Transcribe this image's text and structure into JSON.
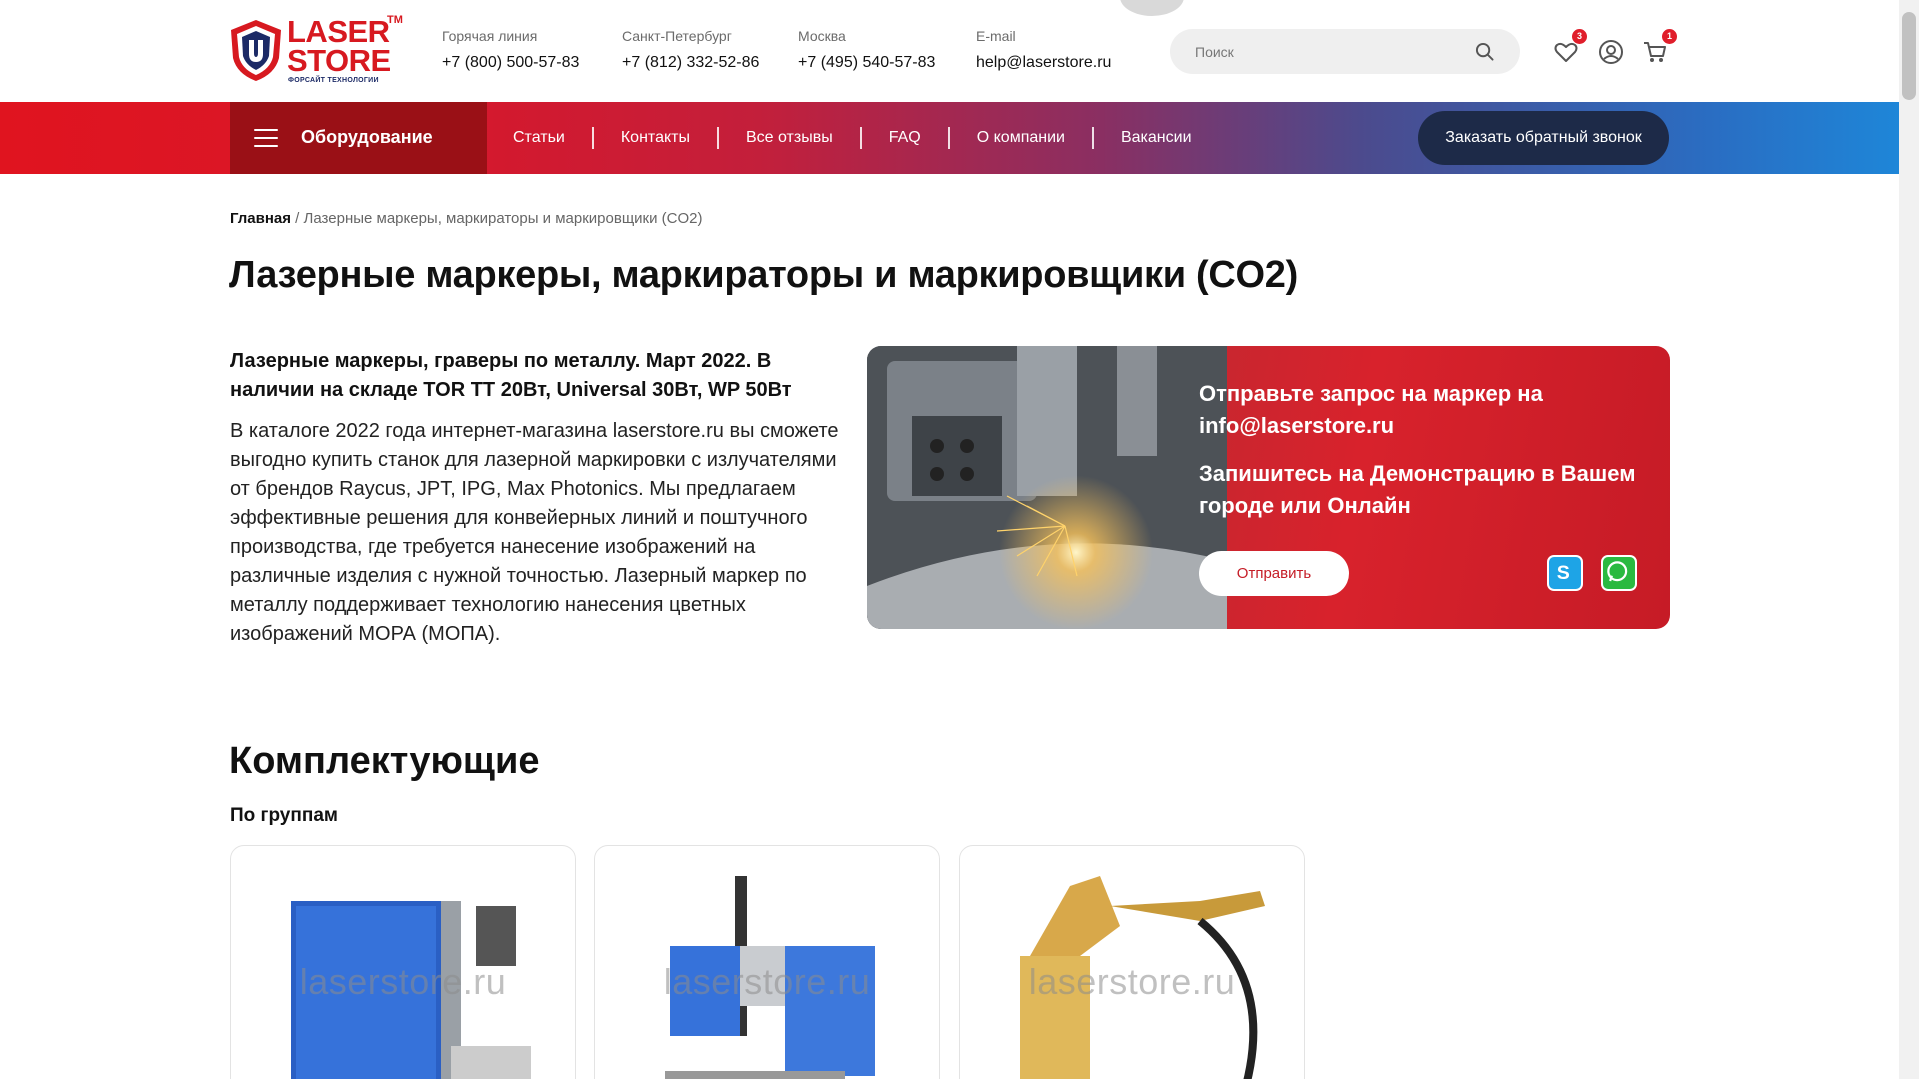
{
  "header": {
    "logo": {
      "line1": "LASER",
      "line2": "STORE",
      "tm": "TM",
      "tagline": "ФОРСАЙТ ТЕХНОЛОГИИ"
    },
    "contacts": [
      {
        "label": "Горячая линия",
        "value": "+7 (800) 500-57-83"
      },
      {
        "label": "Санкт-Петербург",
        "value": "+7 (812) 332-52-86"
      },
      {
        "label": "Москва",
        "value": "+7 (495) 540-57-83"
      },
      {
        "label": "E-mail",
        "value": "help@laserstore.ru"
      }
    ],
    "search": {
      "placeholder": "Поиск",
      "icon": "search-icon"
    },
    "favorites": {
      "icon": "heart-icon",
      "count": "3"
    },
    "account": {
      "icon": "user-circle-icon"
    },
    "cart": {
      "icon": "cart-icon",
      "count": "1"
    }
  },
  "nav": {
    "equipment_label": "Оборудование",
    "links": [
      "Статьи",
      "Контакты",
      "Все отзывы",
      "FAQ",
      "О компании",
      "Вакансии"
    ],
    "callback_label": "Заказать обратный звонок"
  },
  "breadcrumb": {
    "home": "Главная",
    "separator": " / ",
    "current": "Лазерные маркеры, маркираторы и маркировщики (CO2)"
  },
  "page_title": "Лазерные маркеры, маркираторы и маркировщики (CO2)",
  "intro": {
    "lead": "Лазерные маркеры, граверы по металлу. Март 2022. В наличии на складе TOR TT 20Вт, Universal 30Вт, WP 50Вт",
    "description": "В каталоге 2022 года интернет-магазина laserstore.ru вы сможете выгодно купить станок для лазерной маркировки с излучателями от брендов Raycus, JPT, IPG, Max Photonics. Мы предлагаем эффективные решения для конвейерных линий и поштучного производства, где требуется нанесение изображений на различные изделия с нужной точностью. Лазерный маркер по металлу поддерживает технологию нанесения цветных изображений МОРА (МОПА)."
  },
  "promo": {
    "title1": "Отправьте запрос на маркер на info@laserstore.ru",
    "title2": "Запишитесь на Демонстрацию в Вашем городе или Онлайн",
    "send_label": "Отправить"
  },
  "components": {
    "title": "Комплектующие",
    "subtitle": "По группам",
    "cards": [
      {
        "watermark": "laserstore.ru"
      },
      {
        "watermark": "laserstore.ru"
      },
      {
        "watermark": "laserstore.ru"
      }
    ]
  }
}
